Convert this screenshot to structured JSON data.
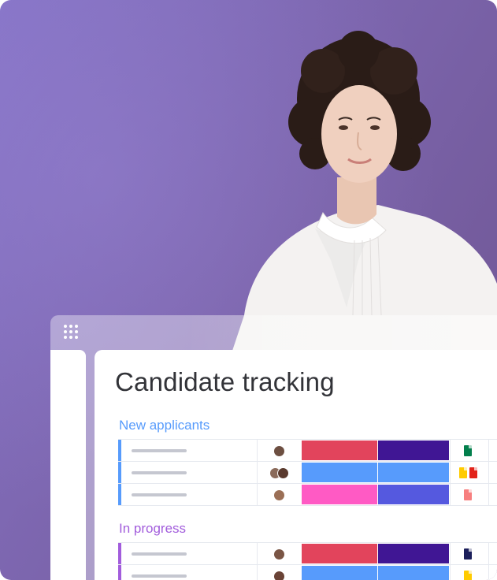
{
  "board": {
    "title": "Candidate tracking"
  },
  "groups": [
    {
      "title": "New applicants",
      "color": "#579bfc",
      "rows": [
        {
          "status1": "#e2445c",
          "status2": "#401694",
          "files": [
            "#037f4c"
          ],
          "avatars": 1
        },
        {
          "status1": "#579bfc",
          "status2": "#579bfc",
          "files": [
            "#ffcb00",
            "#e2231a"
          ],
          "avatars": 2
        },
        {
          "status1": "#ff5ac4",
          "status2": "#5559df",
          "files": [
            "#f77f7f"
          ],
          "avatars": 1
        }
      ]
    },
    {
      "title": "In progress",
      "color": "#a25ddc",
      "rows": [
        {
          "status1": "#e2445c",
          "status2": "#401694",
          "files": [
            "#1c1f5b"
          ],
          "avatars": 1
        },
        {
          "status1": "#579bfc",
          "status2": "#579bfc",
          "files": [
            "#ffcb00"
          ],
          "avatars": 1
        }
      ]
    }
  ],
  "icons": {
    "app_menu": "grid-dots-icon"
  },
  "colors": {
    "background": "#7c65ad",
    "title": "#323338"
  }
}
